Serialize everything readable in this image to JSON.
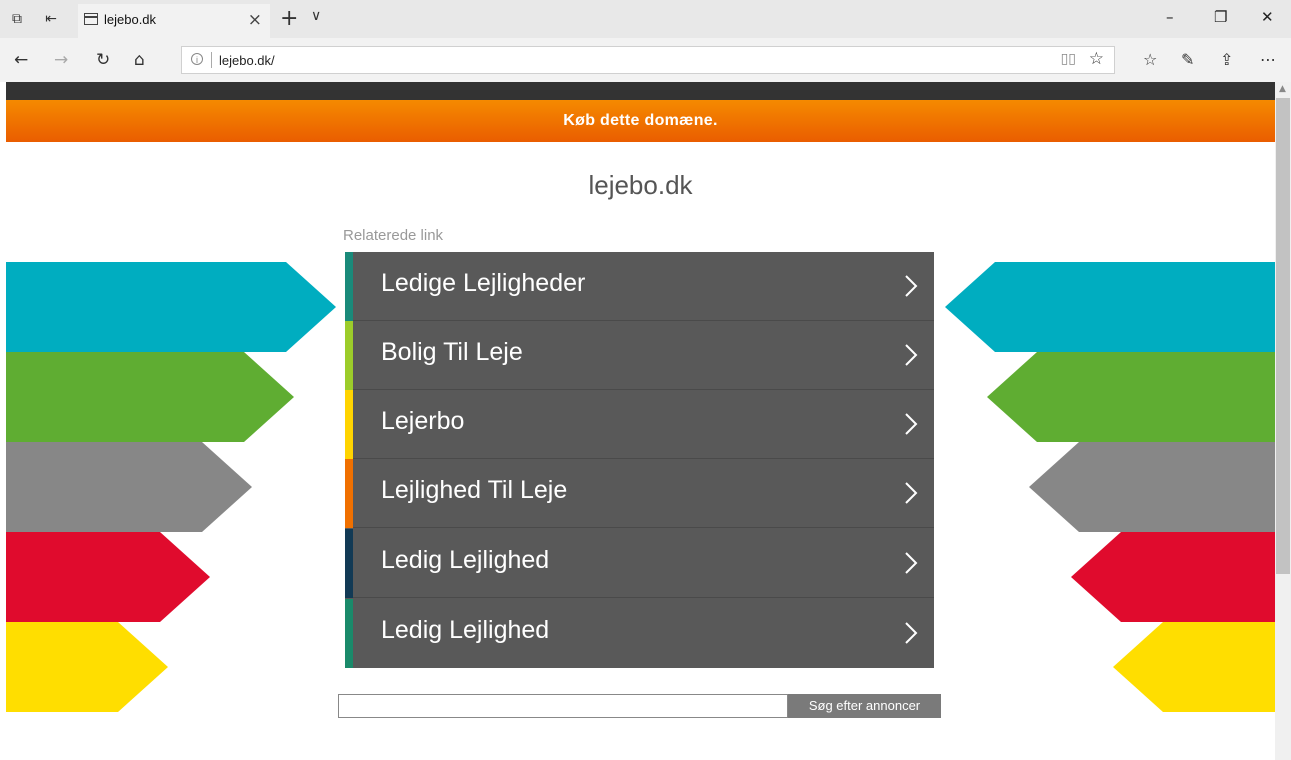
{
  "browser": {
    "tab_title": "lejebo.dk",
    "url": "lejebo.dk/"
  },
  "page": {
    "banner": "Køb dette domæne.",
    "domain": "lejebo.dk",
    "related_label": "Relaterede link",
    "links": [
      {
        "label": "Ledige Lejligheder",
        "stripe": "#1a8a7a"
      },
      {
        "label": "Bolig Til Leje",
        "stripe": "#9ccc2a"
      },
      {
        "label": "Lejerbo",
        "stripe": "#ffd400"
      },
      {
        "label": "Lejlighed Til Leje",
        "stripe": "#f07000"
      },
      {
        "label": "Ledig Lejlighed",
        "stripe": "#123a55"
      },
      {
        "label": "Ledig Lejlighed",
        "stripe": "#1a8a6a"
      }
    ],
    "search_button": "Søg efter annoncer",
    "search_value": ""
  },
  "colors": {
    "arrows": [
      "#00adc0",
      "#5fad32",
      "#878787",
      "#e00b2d",
      "#ffde00"
    ],
    "banner": "#f07000"
  }
}
